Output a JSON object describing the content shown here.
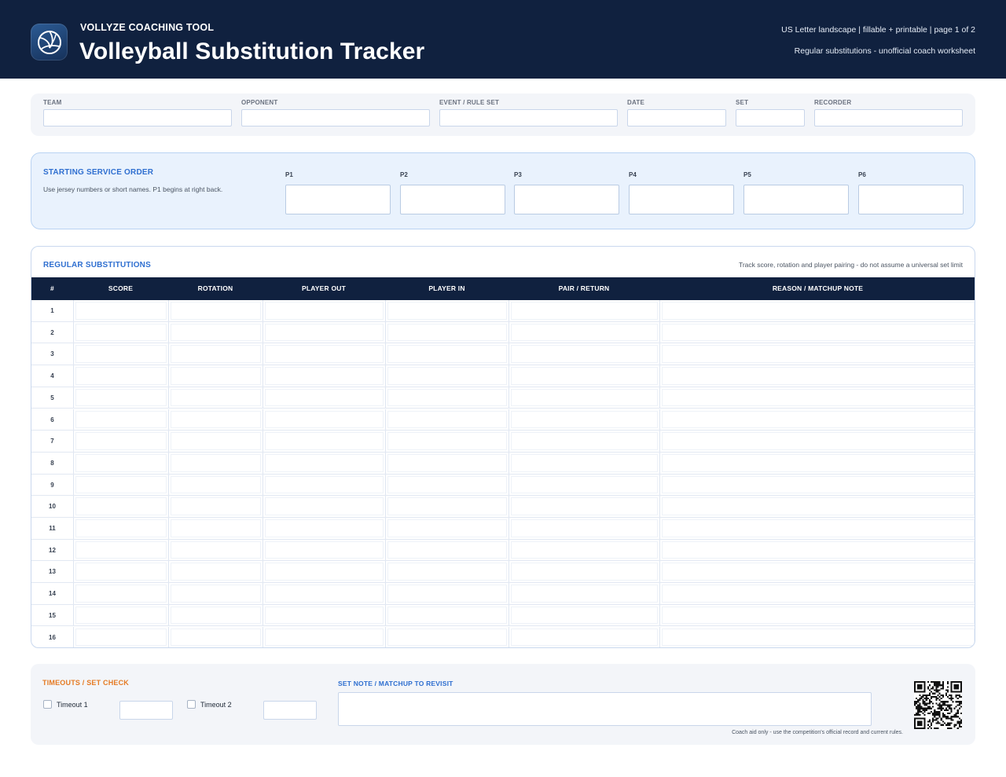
{
  "header": {
    "brand": "VOLLYZE COACHING TOOL",
    "title": "Volleyball Substitution Tracker",
    "meta_line1": "US Letter landscape | fillable + printable | page 1 of 2",
    "meta_line2": "Regular substitutions - unofficial coach worksheet",
    "logo_icon": "volleyball-icon"
  },
  "info_fields": [
    {
      "label": "TEAM",
      "value": ""
    },
    {
      "label": "OPPONENT",
      "value": ""
    },
    {
      "label": "EVENT / RULE SET",
      "value": ""
    },
    {
      "label": "DATE",
      "value": ""
    },
    {
      "label": "SET",
      "value": ""
    },
    {
      "label": "RECORDER",
      "value": ""
    }
  ],
  "service_order": {
    "title": "STARTING SERVICE ORDER",
    "hint": "Use jersey numbers or short names. P1 begins at right back.",
    "positions": [
      "P1",
      "P2",
      "P3",
      "P4",
      "P5",
      "P6"
    ]
  },
  "substitutions": {
    "title": "REGULAR SUBSTITUTIONS",
    "note": "Track score, rotation and player pairing - do not assume a universal set limit",
    "columns": [
      "#",
      "SCORE",
      "ROTATION",
      "PLAYER OUT",
      "PLAYER IN",
      "PAIR / RETURN",
      "REASON / MATCHUP NOTE"
    ],
    "row_numbers": [
      "1",
      "2",
      "3",
      "4",
      "5",
      "6",
      "7",
      "8",
      "9",
      "10",
      "11",
      "12",
      "13",
      "14",
      "15",
      "16"
    ]
  },
  "timeouts": {
    "title": "TIMEOUTS / SET CHECK",
    "timeout1_label": "Timeout 1",
    "timeout2_label": "Timeout 2",
    "timeout1_checked": false,
    "timeout2_checked": false
  },
  "set_note": {
    "title": "SET NOTE / MATCHUP TO REVISIT",
    "value": ""
  },
  "footer": {
    "coach_aid": "Coach aid only - use the competition's official record and current rules.",
    "qr_icon": "qr-code-icon"
  },
  "colors": {
    "header_bg": "#10213f",
    "accent_blue": "#2f6fd0",
    "accent_orange": "#e57a23",
    "panel_bg": "#f3f5f9",
    "order_bg": "#e9f2fd"
  }
}
